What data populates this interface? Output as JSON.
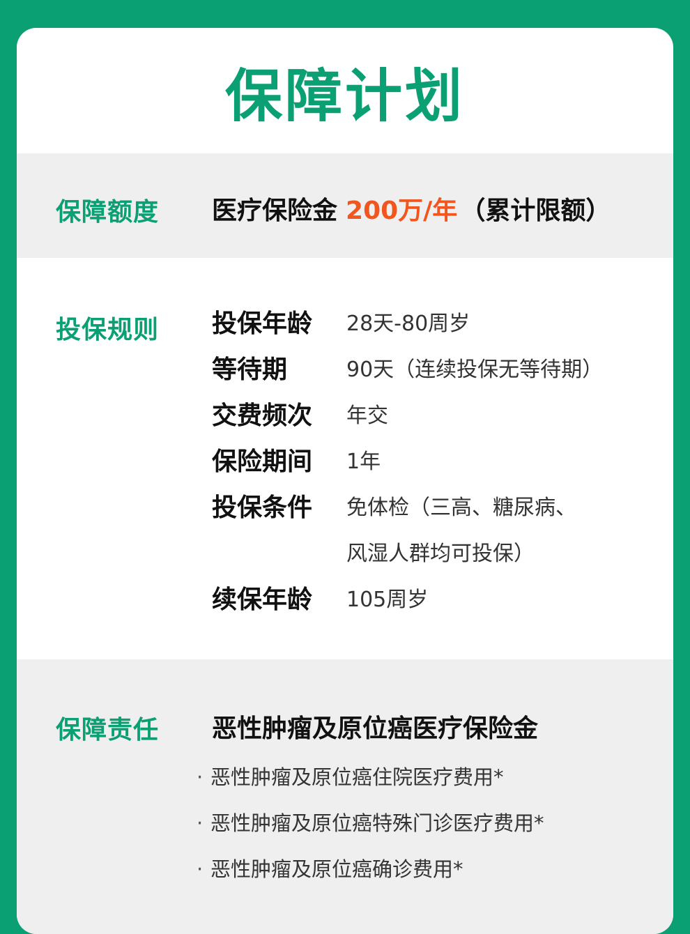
{
  "title": "保障计划",
  "amount": {
    "label": "保障额度",
    "prefix": "医疗保险金",
    "highlight": "200万/年",
    "suffix": "（累计限额）"
  },
  "rules": {
    "label": "投保规则",
    "items": [
      {
        "key": "投保年龄",
        "value": "28天-80周岁"
      },
      {
        "key": "等待期",
        "value": "90天（连续投保无等待期）"
      },
      {
        "key": "交费频次",
        "value": "年交"
      },
      {
        "key": "保险期间",
        "value": "1年"
      },
      {
        "key": "投保条件",
        "value": "免体检（三高、糖尿病、风湿人群均可投保）"
      },
      {
        "key": "续保年龄",
        "value": "105周岁"
      }
    ]
  },
  "duty": {
    "label": "保障责任",
    "title": "恶性肿瘤及原位癌医疗保险金",
    "bullet": "·",
    "items": [
      "恶性肿瘤及原位癌住院医疗费用*",
      "恶性肿瘤及原位癌特殊门诊医疗费用*",
      "恶性肿瘤及原位癌确诊费用*"
    ]
  },
  "colors": {
    "background": "#0aa073",
    "accent": "#0aa073",
    "highlight": "#f0561d",
    "band": "#efefef"
  }
}
